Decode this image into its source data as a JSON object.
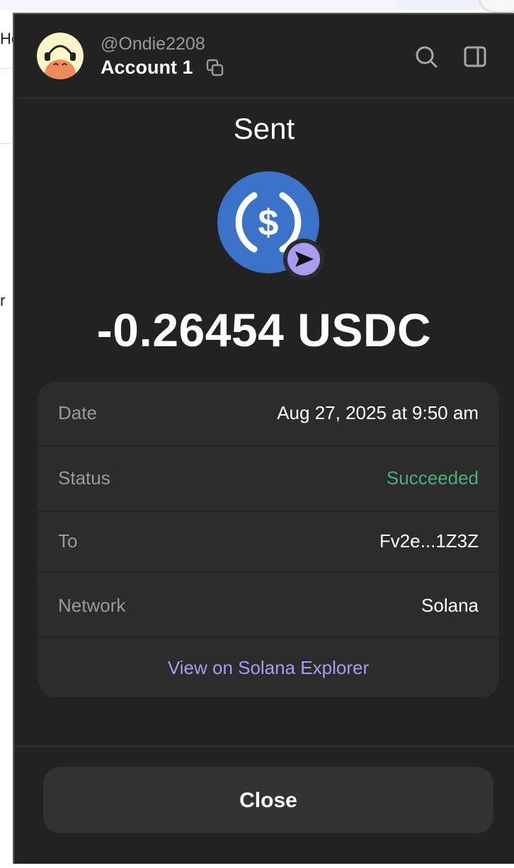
{
  "background": {
    "text_top": "Ho",
    "text_mid": "r"
  },
  "header": {
    "username": "@Ondie2208",
    "account_name": "Account 1",
    "icons": [
      "avatar",
      "copy-icon",
      "search-icon",
      "sidebar-toggle-icon"
    ]
  },
  "transaction": {
    "title": "Sent",
    "token_icon": "usdc-icon",
    "badge_icon": "send-arrow-icon",
    "amount": "-0.26454 USDC",
    "details": [
      {
        "label": "Date",
        "value": "Aug 27, 2025 at 9:50 am"
      },
      {
        "label": "Status",
        "value": "Succeeded"
      },
      {
        "label": "To",
        "value": "Fv2e...1Z3Z"
      },
      {
        "label": "Network",
        "value": "Solana"
      }
    ],
    "explorer_link": "View on Solana Explorer"
  },
  "footer": {
    "close_label": "Close"
  },
  "colors": {
    "panel_bg": "#222222",
    "card_bg": "#2c2c2c",
    "success": "#4caf7a",
    "link": "#a99bf2",
    "usdc_blue": "#3a73c9",
    "badge_purple": "#a99bf2"
  }
}
